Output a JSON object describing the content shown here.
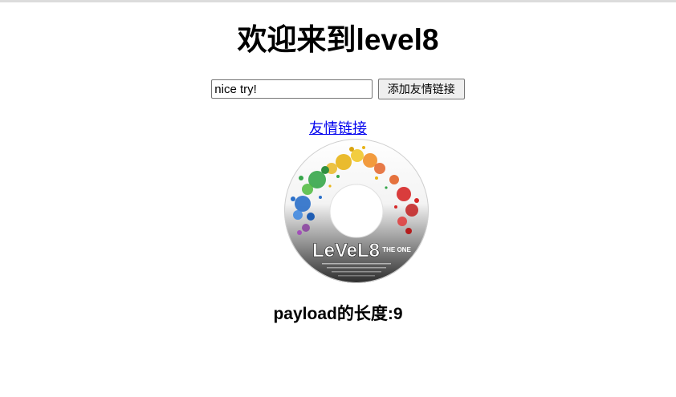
{
  "page": {
    "title": "欢迎来到level8"
  },
  "form": {
    "keyword_value": "nice try!",
    "submit_label": "添加友情链接"
  },
  "link": {
    "label": "友情链接"
  },
  "image": {
    "logo_text": "LeVeL8",
    "logo_subtext": "THE ONE",
    "accent_colors": [
      "#e8b417",
      "#36a64a",
      "#2a6fc9",
      "#d62828",
      "#8a3fa0",
      "#f08a1c"
    ]
  },
  "payload": {
    "length_text": "payload的长度:9"
  }
}
